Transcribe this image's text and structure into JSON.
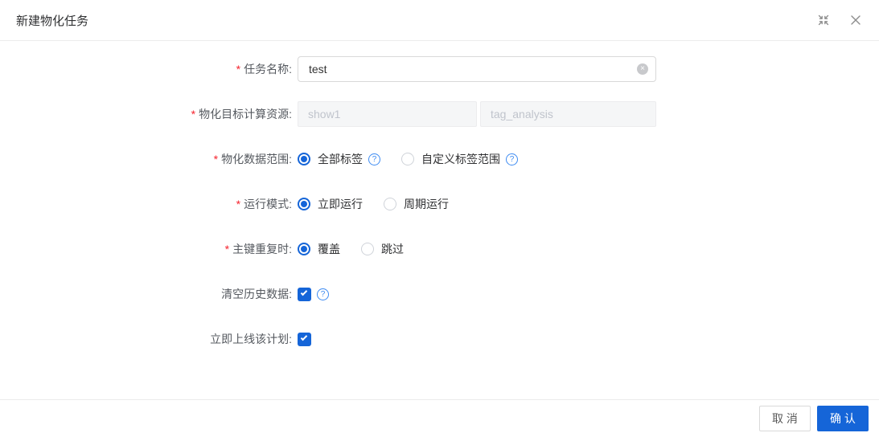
{
  "colors": {
    "primary": "#1565d8",
    "help_blue": "#3d8bf2",
    "required": "#f5222d",
    "border": "#d9d9d9",
    "disabled_bg": "#f5f6f7",
    "divider": "#ececec",
    "placeholder": "#c0c4cc"
  },
  "icons": {
    "fullscreen": "compress-arrows",
    "close": "x",
    "clear": "×",
    "help": "?",
    "check": "checkmark"
  },
  "dialog": {
    "title": "新建物化任务",
    "required_mark": "*"
  },
  "form": {
    "rows": [
      {
        "label": "任务名称:",
        "required": true,
        "type": "input",
        "value": "test",
        "clearable": true
      },
      {
        "label": "物化目标计算资源:",
        "required": true,
        "type": "double-input",
        "disabled": true,
        "values": [
          "show1",
          "tag_analysis"
        ]
      },
      {
        "label": "物化数据范围:",
        "required": true,
        "type": "radio",
        "options": [
          {
            "label": "全部标签",
            "checked": true,
            "help": true
          },
          {
            "label": "自定义标签范围",
            "checked": false,
            "help": true
          }
        ]
      },
      {
        "label": "运行模式:",
        "required": true,
        "type": "radio",
        "options": [
          {
            "label": "立即运行",
            "checked": true
          },
          {
            "label": "周期运行",
            "checked": false
          }
        ]
      },
      {
        "label": "主键重复时:",
        "required": true,
        "type": "radio",
        "options": [
          {
            "label": "覆盖",
            "checked": true
          },
          {
            "label": "跳过",
            "checked": false
          }
        ]
      },
      {
        "label": "清空历史数据:",
        "required": false,
        "type": "checkbox",
        "checked": true,
        "help": true
      },
      {
        "label": "立即上线该计划:",
        "required": false,
        "type": "checkbox",
        "checked": true
      }
    ]
  },
  "footer": {
    "cancel_label": "取 消",
    "confirm_label": "确 认"
  }
}
